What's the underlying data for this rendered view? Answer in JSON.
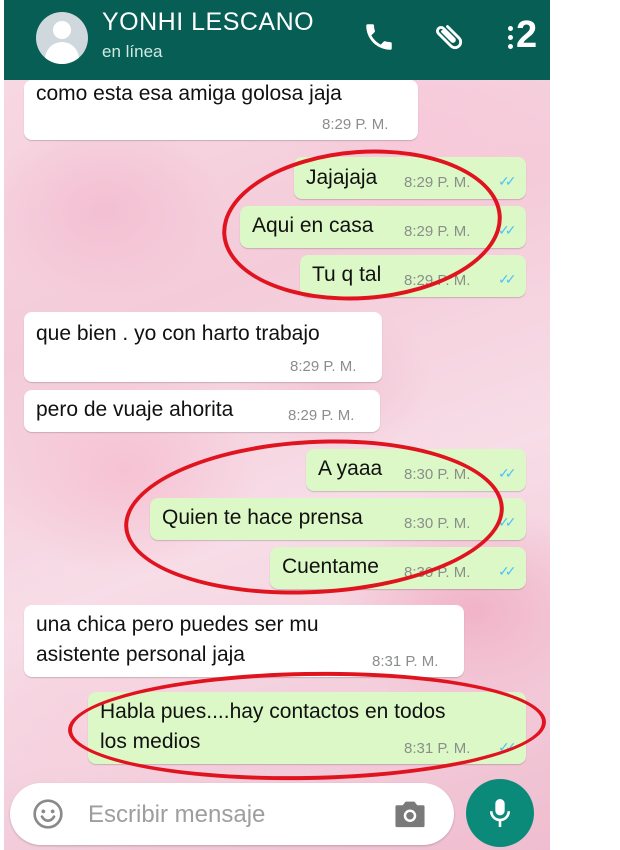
{
  "header": {
    "contact_name": "YONHI LESCANO",
    "status": "en línea",
    "icons": [
      "phone-icon",
      "paperclip-icon",
      "more-options-icon"
    ],
    "annotation_number": "2",
    "background_color": "#075e54"
  },
  "messages": [
    {
      "direction": "in",
      "text": "como esta esa amiga golosa jaja",
      "time": "8:29 P. M."
    },
    {
      "direction": "out",
      "text": "Jajajaja",
      "time": "8:29 P. M."
    },
    {
      "direction": "out",
      "text": "Aqui en casa",
      "time": "8:29 P. M."
    },
    {
      "direction": "out",
      "text": "Tu q tal",
      "time": "8:29 P. M."
    },
    {
      "direction": "in",
      "text": "que bien . yo con harto trabajo",
      "time": "8:29 P. M."
    },
    {
      "direction": "in",
      "text": "pero de vuaje ahorita",
      "time": "8:29 P. M."
    },
    {
      "direction": "out",
      "text": "A yaaa",
      "time": "8:30 P. M."
    },
    {
      "direction": "out",
      "text": "Quien te hace prensa",
      "time": "8:30 P. M."
    },
    {
      "direction": "out",
      "text": "Cuentame",
      "time": "8:30 P. M."
    },
    {
      "direction": "in",
      "text_lines": [
        "una chica pero puedes ser mu",
        "asistente personal jaja"
      ],
      "time": "8:31 P. M."
    },
    {
      "direction": "out",
      "text_lines": [
        "Habla pues....hay contactos en todos",
        "los medios"
      ],
      "time": "8:31 P. M."
    }
  ],
  "read_ticks": "✓✓",
  "composer": {
    "placeholder": "Escribir mensaje",
    "icons": [
      "emoji-icon",
      "camera-icon",
      "microphone-icon"
    ]
  },
  "colors": {
    "incoming_bubble": "#ffffff",
    "outgoing_bubble": "#dcf8c6",
    "read_ticks": "#4fc3f7",
    "highlight_circle": "#e0141e",
    "mic_button": "#0b8a7a"
  }
}
